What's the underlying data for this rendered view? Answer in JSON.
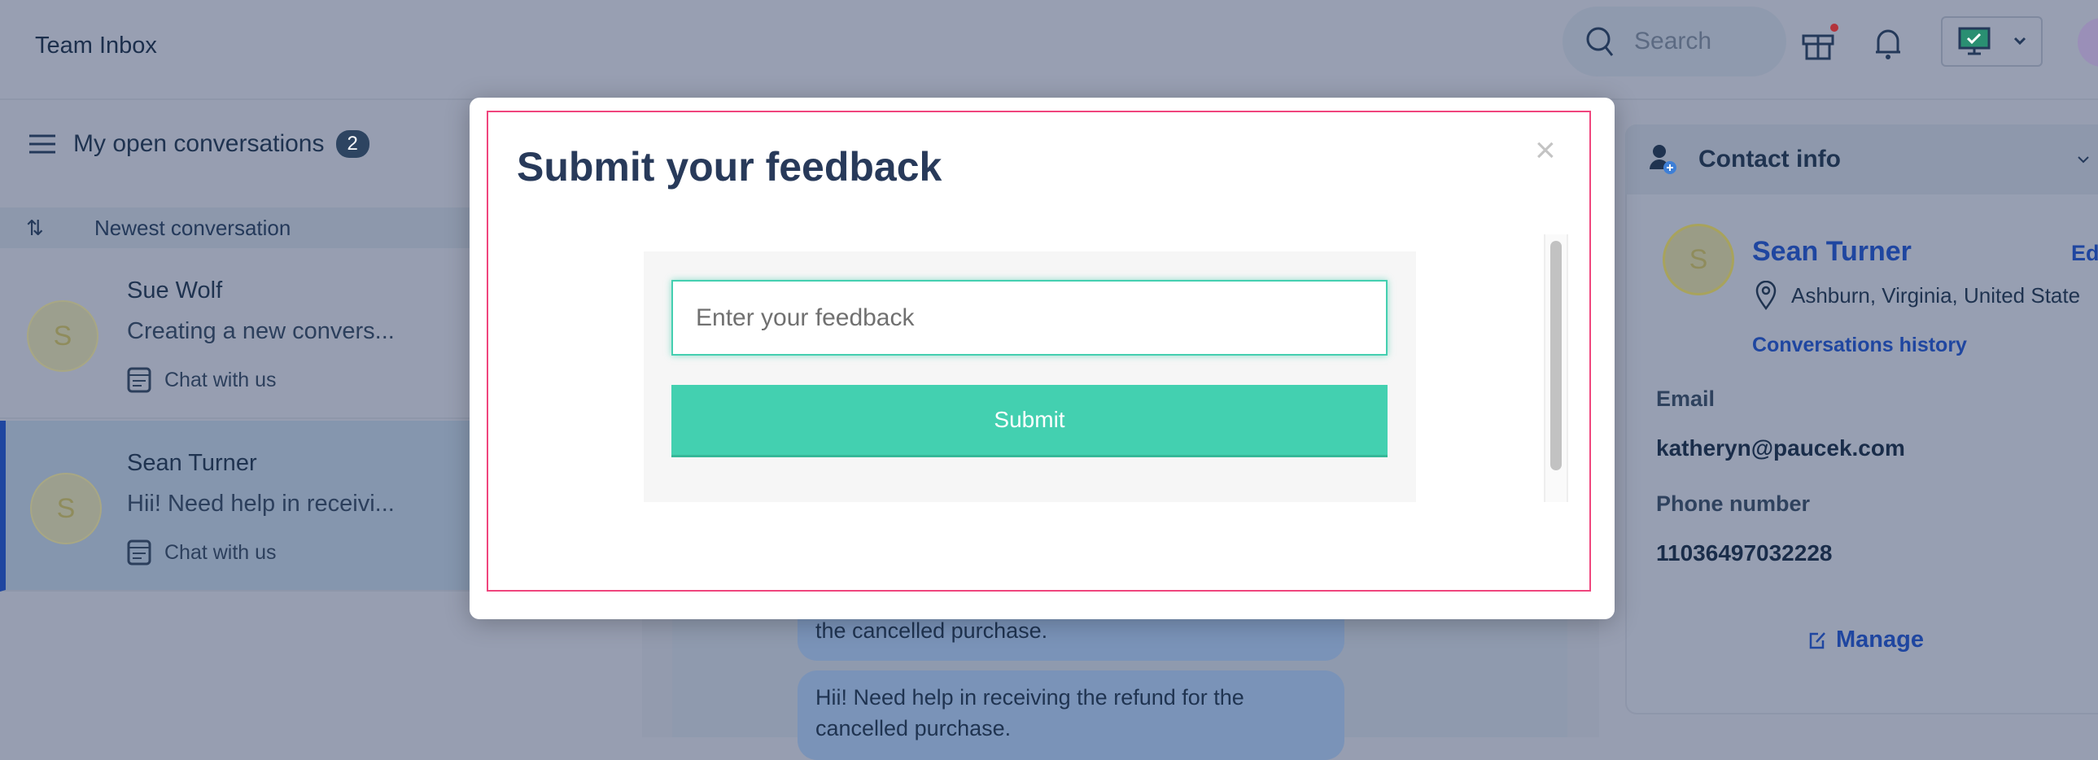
{
  "header": {
    "title": "Team Inbox",
    "search_placeholder": "Search"
  },
  "conversations": {
    "title": "My open conversations",
    "count": "2",
    "sort_label": "Newest conversation",
    "items": [
      {
        "avatar": "S",
        "name": "Sue Wolf",
        "preview": "Creating a new convers...",
        "channel": "Chat with us",
        "selected": false
      },
      {
        "avatar": "S",
        "name": "Sean Turner",
        "preview": "Hii! Need help in receivi...",
        "channel": "Chat with us",
        "selected": true
      }
    ]
  },
  "chat": {
    "messages": [
      "the cancelled purchase.",
      "Hii! Need help in receiving the refund for the cancelled purchase."
    ]
  },
  "contact": {
    "header": "Contact info",
    "avatar": "S",
    "name": "Sean Turner",
    "edit": "Ed",
    "location": "Ashburn, Virginia, United State",
    "history_link": "Conversations history",
    "email_label": "Email",
    "email": "katheryn@paucek.com",
    "phone_label": "Phone number",
    "phone": "11036497032228",
    "manage": "Manage"
  },
  "modal": {
    "title": "Submit your feedback",
    "input_placeholder": "Enter your feedback",
    "submit_label": "Submit",
    "close": "×"
  },
  "colors": {
    "accent": "#43d0b0",
    "frame": "#f0457d",
    "selected_bar": "#1f46a0"
  }
}
